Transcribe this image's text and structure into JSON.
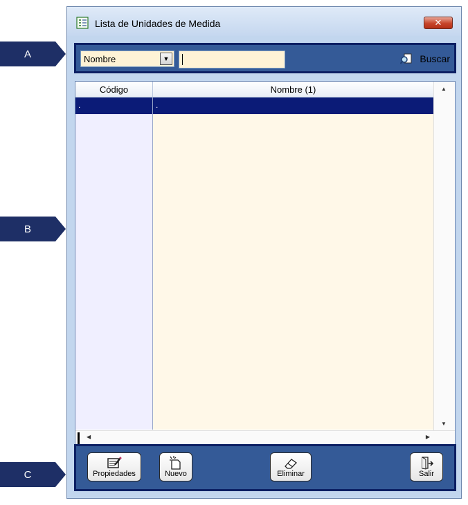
{
  "callouts": {
    "a": "A",
    "b": "B",
    "c": "C"
  },
  "window": {
    "title": "Lista de Unidades de Medida",
    "close_glyph": "✕"
  },
  "search": {
    "field_value": "Nombre",
    "dropdown_glyph": "▼",
    "input_value": "",
    "button_label": "Buscar"
  },
  "grid": {
    "columns": [
      "Código",
      "Nombre (1)"
    ],
    "rows": [
      {
        "code": ".",
        "name": "."
      },
      {
        "code": "",
        "name": ""
      },
      {
        "code": "",
        "name": ""
      },
      {
        "code": "",
        "name": ""
      },
      {
        "code": "",
        "name": ""
      },
      {
        "code": "",
        "name": ""
      },
      {
        "code": "",
        "name": ""
      },
      {
        "code": "",
        "name": ""
      },
      {
        "code": "",
        "name": ""
      },
      {
        "code": "",
        "name": ""
      },
      {
        "code": "",
        "name": ""
      },
      {
        "code": "",
        "name": ""
      },
      {
        "code": "",
        "name": ""
      },
      {
        "code": "",
        "name": ""
      },
      {
        "code": "",
        "name": ""
      },
      {
        "code": "",
        "name": ""
      },
      {
        "code": "",
        "name": ""
      },
      {
        "code": "",
        "name": ""
      },
      {
        "code": "",
        "name": ""
      },
      {
        "code": "",
        "name": ""
      }
    ],
    "scroll_up": "▲",
    "scroll_down": "▼",
    "scroll_left": "◀",
    "scroll_right": "▶"
  },
  "actions": {
    "properties": "Propiedades",
    "new": "Nuevo",
    "delete": "Eliminar",
    "exit": "Salir"
  },
  "colors": {
    "panel_fill": "#345a97",
    "panel_border": "#0c1f63",
    "selected_row": "#0b1b77",
    "callout": "#1e2f66"
  }
}
